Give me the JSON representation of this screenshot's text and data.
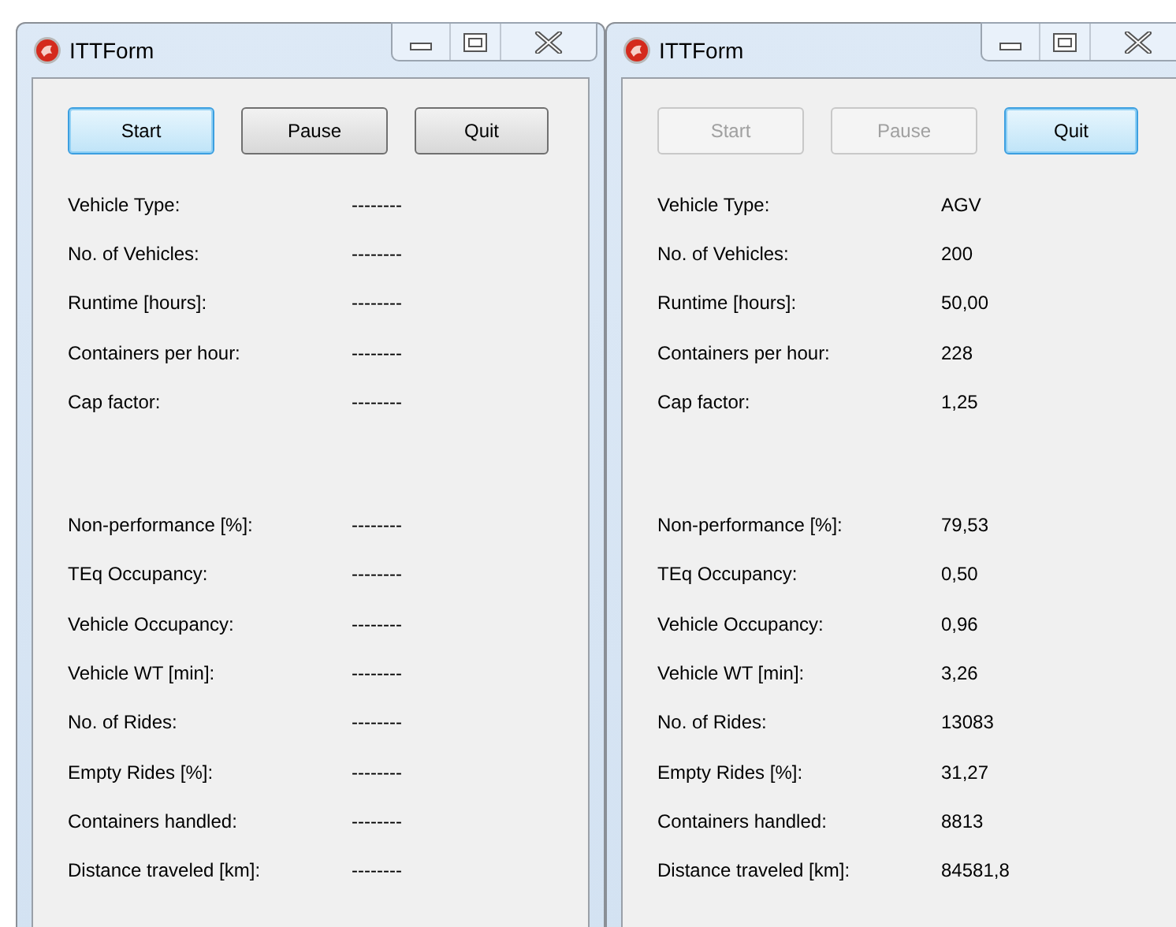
{
  "windows": [
    {
      "title": "ITTForm",
      "buttons": [
        {
          "label": "Start",
          "focused": true,
          "disabled": false
        },
        {
          "label": "Pause",
          "focused": false,
          "disabled": false
        },
        {
          "label": "Quit",
          "focused": false,
          "disabled": false
        }
      ],
      "groups": [
        [
          {
            "label": "Vehicle Type:",
            "value": "--------"
          },
          {
            "label": "No. of Vehicles:",
            "value": "--------"
          },
          {
            "label": "Runtime [hours]:",
            "value": "--------"
          },
          {
            "label": "Containers per hour:",
            "value": "--------"
          },
          {
            "label": "Cap factor:",
            "value": "--------"
          }
        ],
        [
          {
            "label": "Non-performance [%]:",
            "value": "--------"
          },
          {
            "label": "TEq Occupancy:",
            "value": "--------"
          },
          {
            "label": "Vehicle Occupancy:",
            "value": "--------"
          },
          {
            "label": "Vehicle WT [min]:",
            "value": "--------"
          },
          {
            "label": "No. of Rides:",
            "value": "--------"
          },
          {
            "label": "Empty Rides [%]:",
            "value": "--------"
          },
          {
            "label": "Containers handled:",
            "value": "--------"
          },
          {
            "label": "Distance traveled [km]:",
            "value": "--------"
          }
        ]
      ]
    },
    {
      "title": "ITTForm",
      "buttons": [
        {
          "label": "Start",
          "focused": false,
          "disabled": true
        },
        {
          "label": "Pause",
          "focused": false,
          "disabled": true
        },
        {
          "label": "Quit",
          "focused": true,
          "disabled": false
        }
      ],
      "groups": [
        [
          {
            "label": "Vehicle Type:",
            "value": "AGV"
          },
          {
            "label": "No. of Vehicles:",
            "value": "200"
          },
          {
            "label": "Runtime [hours]:",
            "value": "50,00"
          },
          {
            "label": "Containers per hour:",
            "value": "228"
          },
          {
            "label": "Cap factor:",
            "value": "1,25"
          }
        ],
        [
          {
            "label": "Non-performance [%]:",
            "value": "79,53"
          },
          {
            "label": "TEq Occupancy:",
            "value": "0,50"
          },
          {
            "label": "Vehicle Occupancy:",
            "value": "0,96"
          },
          {
            "label": "Vehicle WT [min]:",
            "value": "3,26"
          },
          {
            "label": "No. of Rides:",
            "value": "13083"
          },
          {
            "label": "Empty Rides [%]:",
            "value": "31,27"
          },
          {
            "label": "Containers handled:",
            "value": "8813"
          },
          {
            "label": "Distance traveled [km]:",
            "value": "84581,8"
          }
        ]
      ]
    }
  ]
}
